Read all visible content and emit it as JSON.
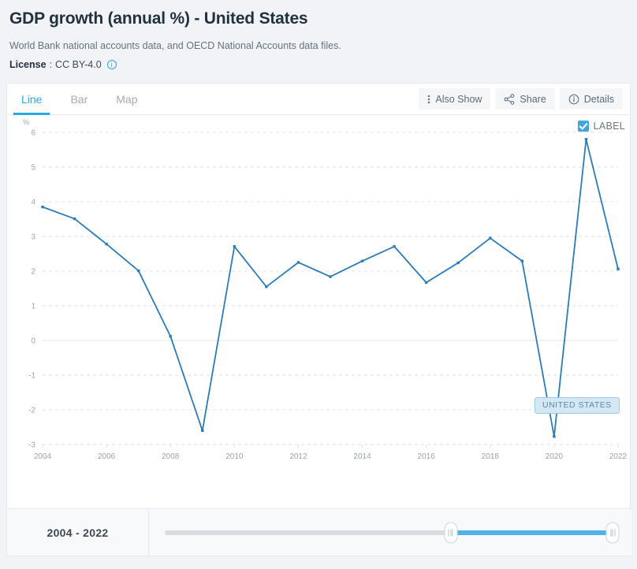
{
  "header": {
    "title": "GDP growth (annual %) - United States",
    "source": "World Bank national accounts data, and OECD National Accounts data files.",
    "license_label": "License",
    "license_sep": ":",
    "license_value": "CC BY-4.0",
    "info_icon_glyph": "i"
  },
  "tabs": [
    {
      "label": "Line",
      "active": true
    },
    {
      "label": "Bar",
      "active": false
    },
    {
      "label": "Map",
      "active": false
    }
  ],
  "toolbar": {
    "also_show_label": "Also Show",
    "share_label": "Share",
    "details_label": "Details"
  },
  "chart_controls": {
    "label_checkbox_text": "LABEL",
    "label_checkbox_checked": true,
    "series_badge": "UNITED STATES"
  },
  "footer": {
    "range_label": "2004 - 2022"
  },
  "colors": {
    "accent": "#29abe2",
    "line": "#2b7cb8",
    "slider_fill": "#4fb3e8",
    "badge_bg": "#d4e7f5",
    "badge_border": "#9ec9e6",
    "grid": "#dfe3e8",
    "zero_line": "#e3e7ea",
    "axis_text": "#9aa4ad",
    "title_text": "#22313f"
  },
  "chart_data": {
    "type": "line",
    "title": "GDP growth (annual %) - United States",
    "xlabel": "",
    "ylabel": "%",
    "ylim": [
      -3,
      6
    ],
    "yticks": [
      6,
      5,
      4,
      3,
      2,
      1,
      0,
      -1,
      -2,
      -3
    ],
    "xlim": [
      2004,
      2022
    ],
    "xticks": [
      2004,
      2006,
      2008,
      2010,
      2012,
      2014,
      2016,
      2018,
      2020,
      2022
    ],
    "grid": true,
    "legend": "UNITED STATES",
    "legend_position": "inline-right",
    "x": [
      2004,
      2005,
      2006,
      2007,
      2008,
      2009,
      2010,
      2011,
      2012,
      2013,
      2014,
      2015,
      2016,
      2017,
      2018,
      2019,
      2020,
      2021,
      2022
    ],
    "series": [
      {
        "name": "UNITED STATES",
        "values": [
          3.85,
          3.51,
          2.78,
          2.01,
          0.12,
          -2.6,
          2.71,
          1.55,
          2.25,
          1.84,
          2.29,
          2.71,
          1.67,
          2.24,
          2.95,
          2.29,
          -2.77,
          5.8,
          2.06
        ]
      }
    ]
  }
}
